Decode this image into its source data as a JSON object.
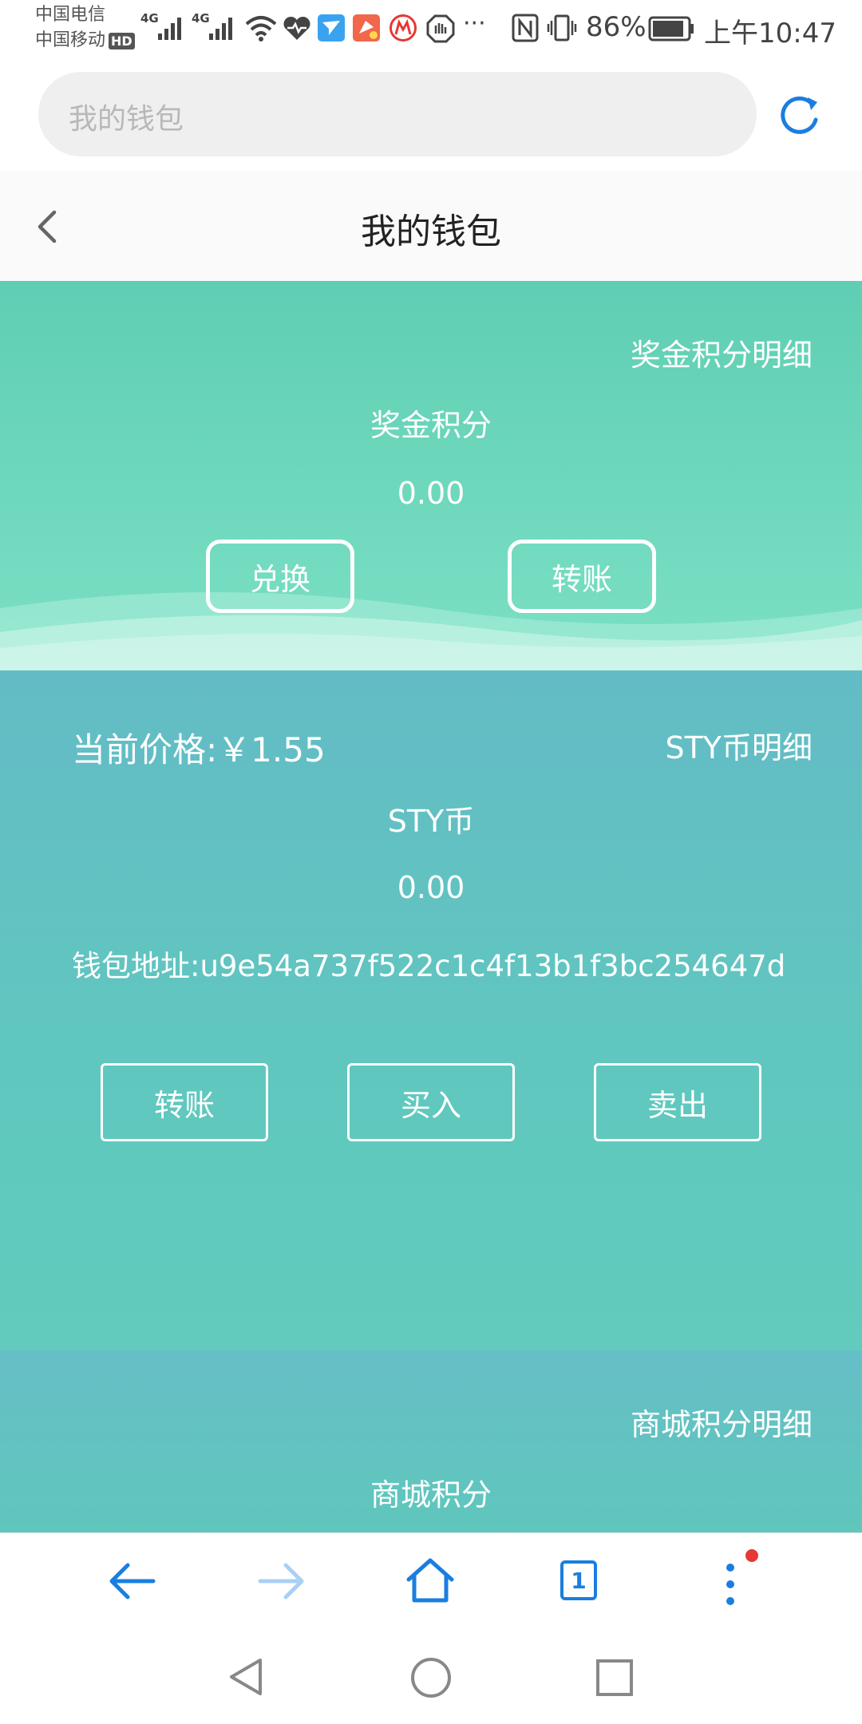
{
  "status_bar": {
    "carrier1": "中国电信",
    "carrier2": "中国移动",
    "hd": "HD",
    "net1": "4G",
    "net2": "4G",
    "more": "···",
    "battery": "86%",
    "time": "上午10:47"
  },
  "browser": {
    "search_placeholder": "我的钱包"
  },
  "page": {
    "title": "我的钱包"
  },
  "bonus": {
    "detail_link": "奖金积分明细",
    "label": "奖金积分",
    "value": "0.00",
    "exchange_button": "兑换",
    "transfer_button": "转账"
  },
  "sty": {
    "price_text": "当前价格:￥1.55",
    "detail_link": "STY币明细",
    "label": "STY币",
    "value": "0.00",
    "address_text": "钱包地址:u9e54a737f522c1c4f13b1f3bc254647d",
    "transfer_button": "转账",
    "buy_button": "买入",
    "sell_button": "卖出"
  },
  "mall": {
    "detail_link": "商城积分明细",
    "label": "商城积分"
  },
  "bottom_nav": {
    "tab_count": "1"
  },
  "colors": {
    "accent_blue": "#1a7ee0",
    "section1": "#6ad8bc",
    "section2": "#62c2c1",
    "notify_dot": "#e53935"
  }
}
